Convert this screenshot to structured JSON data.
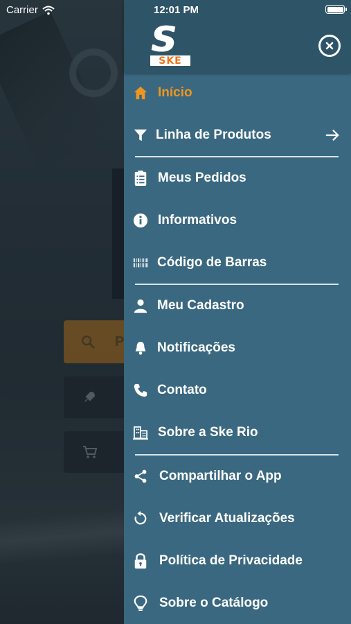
{
  "status_bar": {
    "carrier": "Carrier",
    "time": "12:01 PM"
  },
  "background": {
    "search_label": "P"
  },
  "drawer": {
    "logo": {
      "text": "SKE"
    },
    "menu": [
      {
        "label": "Início",
        "icon": "home-icon",
        "active": true
      },
      {
        "label": "Linha de Produtos",
        "icon": "filter-icon",
        "has_arrow": true
      },
      {
        "label": "Meus Pedidos",
        "icon": "clipboard-list-icon"
      },
      {
        "label": "Informativos",
        "icon": "info-icon"
      },
      {
        "label": "Código de Barras",
        "icon": "barcode-icon"
      },
      {
        "label": "Meu Cadastro",
        "icon": "user-icon"
      },
      {
        "label": "Notificações",
        "icon": "bell-icon"
      },
      {
        "label": "Contato",
        "icon": "phone-icon"
      },
      {
        "label": "Sobre a Ske Rio",
        "icon": "buildings-icon"
      },
      {
        "label": "Compartilhar o App",
        "icon": "share-icon"
      },
      {
        "label": "Verificar Atualizações",
        "icon": "refresh-icon"
      },
      {
        "label": "Política de Privacidade",
        "icon": "lock-icon"
      },
      {
        "label": "Sobre o Catálogo",
        "icon": "lightbulb-icon"
      }
    ]
  },
  "colors": {
    "drawer_bg": "#3a6880",
    "header_bg": "#2e5468",
    "accent": "#f0951e",
    "text": "#ffffff"
  }
}
